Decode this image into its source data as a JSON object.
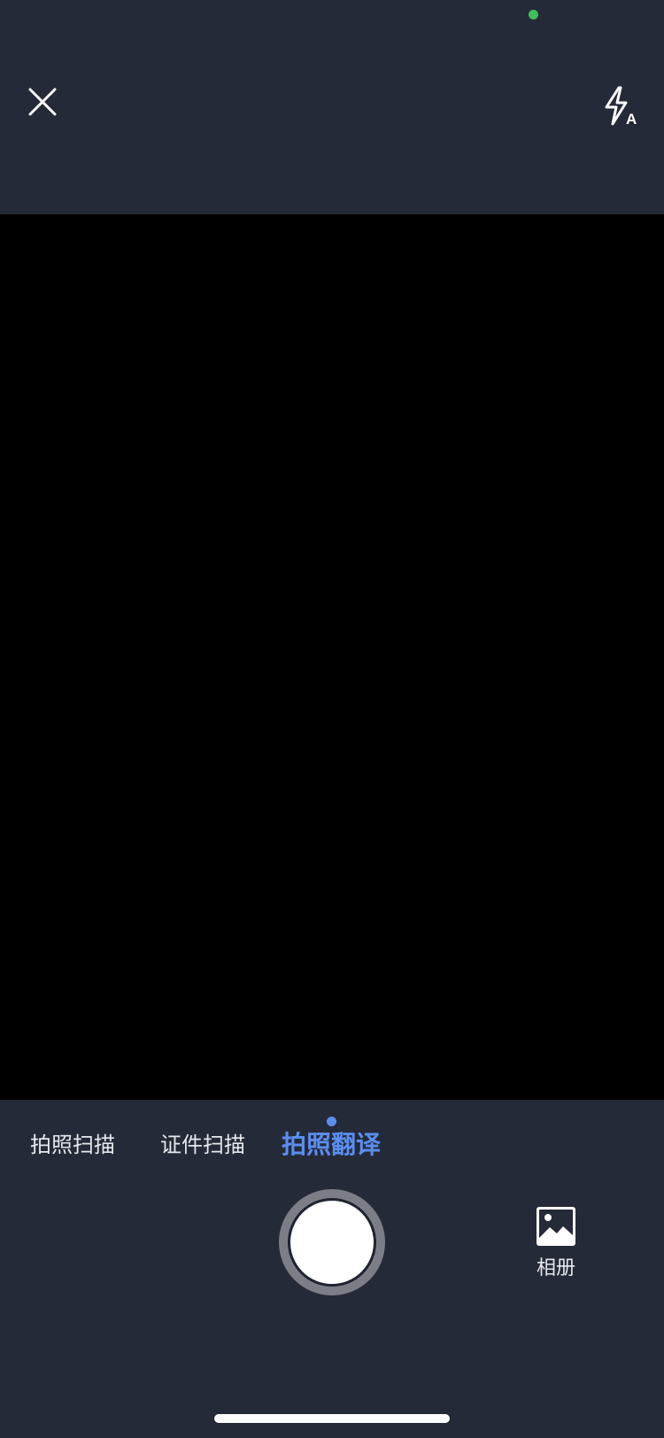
{
  "top_bar": {
    "close_icon": "close-icon",
    "flash_icon": "flash-auto-icon"
  },
  "status": {
    "indicator_color": "#3fbf5a"
  },
  "modes": {
    "items": [
      {
        "label": "拍照扫描",
        "active": false
      },
      {
        "label": "证件扫描",
        "active": false
      },
      {
        "label": "拍照翻译",
        "active": true
      }
    ],
    "active_color": "#5b8ef0"
  },
  "controls": {
    "shutter_icon": "shutter-button",
    "album_icon": "image-icon",
    "album_label": "相册"
  },
  "theme": {
    "background": "#252a38",
    "viewfinder": "#000000"
  }
}
